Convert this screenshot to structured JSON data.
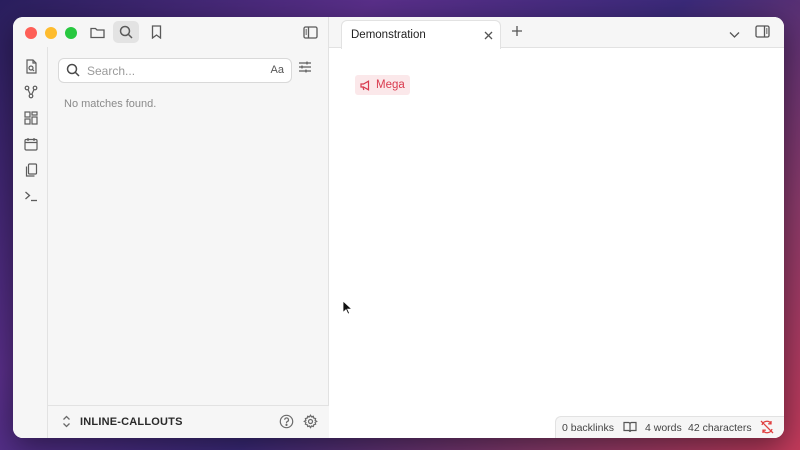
{
  "window": {
    "traffic_lights": {
      "close": "#fe5f57",
      "minimize": "#febc2e",
      "zoom": "#28c840"
    }
  },
  "titlebar_left": {
    "icons": [
      "folder-icon",
      "search-icon",
      "bookmark-icon",
      "sidebar-toggle-icon"
    ]
  },
  "ribbon": {
    "icons": [
      "open-quick-switcher-icon",
      "graph-view-icon",
      "canvas-icon",
      "daily-note-icon",
      "templates-icon",
      "command-palette-icon"
    ]
  },
  "search": {
    "placeholder": "Search...",
    "value": "",
    "match_case_label": "Aa",
    "empty_message": "No matches found."
  },
  "vault": {
    "name": "INLINE-CALLOUTS"
  },
  "tabs": [
    {
      "label": "Demonstration",
      "active": true
    }
  ],
  "editor": {
    "callout": {
      "icon": "megaphone-icon",
      "label": "Mega",
      "color": "#d93a4e",
      "background": "#fbe8ea"
    }
  },
  "statusbar": {
    "backlinks": "0 backlinks",
    "words": "4 words",
    "characters": "42 characters",
    "sync_status_color": "#e04040"
  }
}
